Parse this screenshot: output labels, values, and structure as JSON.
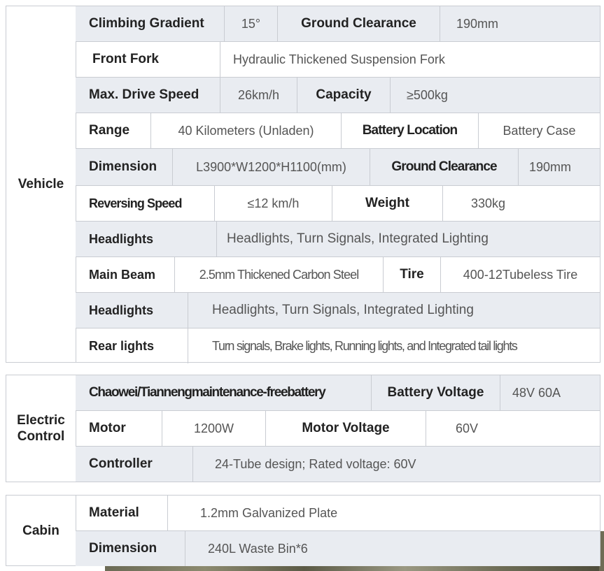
{
  "vehicle": {
    "category": "Vehicle",
    "climbing_gradient_label": "Climbing Gradient",
    "climbing_gradient_value": "15°",
    "ground_clearance_label": "Ground Clearance",
    "ground_clearance_value": "190mm",
    "front_fork_label": "Front Fork",
    "front_fork_value": "Hydraulic Thickened Suspension Fork",
    "max_speed_label": "Max. Drive Speed",
    "max_speed_value": "26km/h",
    "capacity_label": "Capacity",
    "capacity_value": "≥500kg",
    "range_label": "Range",
    "range_value": "40 Kilometers (Unladen)",
    "battery_location_label": "Battery Location",
    "battery_location_value": "Battery Case",
    "dimension_label": "Dimension",
    "dimension_value": "L3900*W1200*H1100(mm)",
    "ground_clearance2_label": "Ground Clearance",
    "ground_clearance2_value": "190mm",
    "reversing_speed_label": "Reversing Speed",
    "reversing_speed_value": "≤12 km/h",
    "weight_label": "Weight",
    "weight_value": "330kg",
    "headlights_label": "Headlights",
    "headlights_value": "Headlights, Turn Signals, Integrated Lighting",
    "main_beam_label": "Main Beam",
    "main_beam_value": "2.5mm Thickened Carbon Steel",
    "tire_label": "Tire",
    "tire_value": "400-12Tubeless Tire",
    "headlights2_label": "Headlights",
    "headlights2_value": "Headlights, Turn Signals, Integrated Lighting",
    "rear_lights_label": "Rear lights",
    "rear_lights_value": "Turn signals, Brake lights, Running lights, and Integrated tail lights"
  },
  "electric": {
    "category_line1": "Electric",
    "category_line2": "Control",
    "battery_label": "Chaowei/Tiannengmaintenance-freebattery",
    "battery_voltage_label": "Battery Voltage",
    "battery_voltage_value": "48V 60A",
    "motor_label": "Motor",
    "motor_value": "1200W",
    "motor_voltage_label": "Motor Voltage",
    "motor_voltage_value": "60V",
    "controller_label": "Controller",
    "controller_value": "24-Tube design; Rated voltage: 60V"
  },
  "cabin": {
    "category": "Cabin",
    "material_label": "Material",
    "material_value": "1.2mm Galvanized Plate",
    "dimension_label": "Dimension",
    "dimension_value": "240L Waste Bin*6"
  }
}
